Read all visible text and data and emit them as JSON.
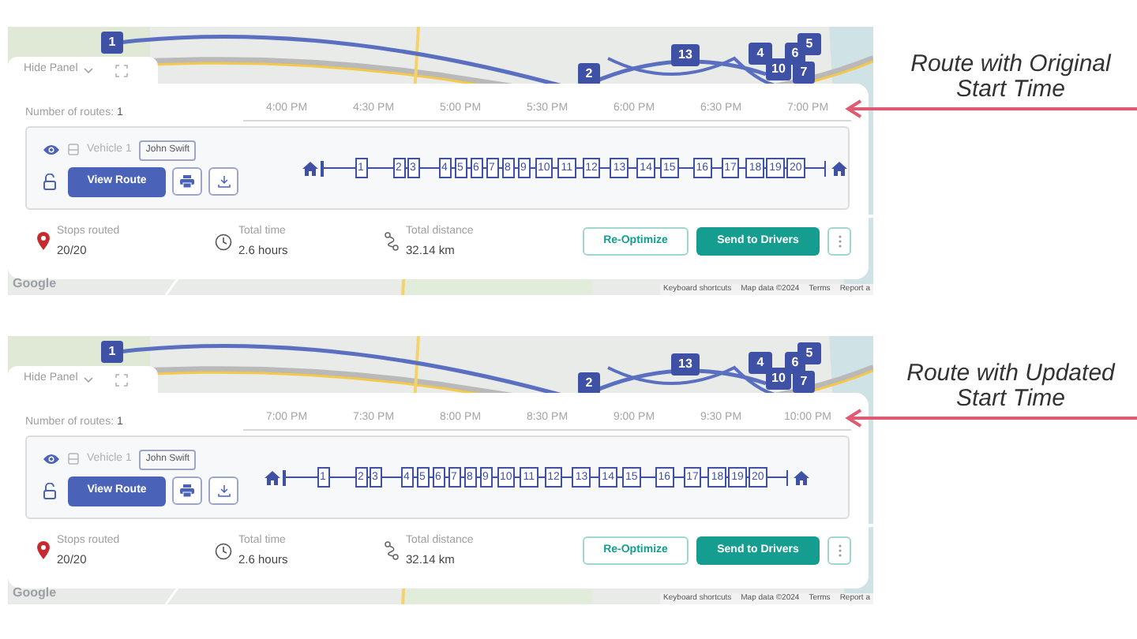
{
  "panels": [
    {
      "markers": [
        "1",
        "2",
        "13",
        "4",
        "5",
        "6",
        "10",
        "7"
      ],
      "hide_panel": "Hide Panel",
      "routes_label": "Number of routes:",
      "routes_count": "1",
      "time_axis": [
        "4:00 PM",
        "4:30 PM",
        "5:00 PM",
        "5:30 PM",
        "6:00 PM",
        "6:30 PM",
        "7:00 PM"
      ],
      "vehicle": "Vehicle 1",
      "driver": "John Swift",
      "view_route": "View Route",
      "stops": [
        "1",
        "2",
        "3",
        "4",
        "5",
        "6",
        "7",
        "8",
        "9",
        "10",
        "11",
        "12",
        "13",
        "14",
        "15",
        "16",
        "17",
        "18",
        "19",
        "20"
      ],
      "stats": [
        {
          "kind": "pin",
          "label": "Stops routed",
          "value": "20/20"
        },
        {
          "kind": "clock",
          "label": "Total time",
          "value": "2.6 hours"
        },
        {
          "kind": "route",
          "label": "Total distance",
          "value": "32.14 km"
        }
      ],
      "reoptimize": "Re-Optimize",
      "send": "Send to Drivers",
      "google": "Google",
      "attribution": [
        "Keyboard shortcuts",
        "Map data ©2024",
        "Terms",
        "Report a"
      ],
      "annotation": [
        "Route with Original",
        "Start Time"
      ]
    },
    {
      "markers": [
        "1",
        "2",
        "13",
        "4",
        "5",
        "6",
        "10",
        "7"
      ],
      "hide_panel": "Hide Panel",
      "routes_label": "Number of routes:",
      "routes_count": "1",
      "time_axis": [
        "7:00 PM",
        "7:30 PM",
        "8:00 PM",
        "8:30 PM",
        "9:00 PM",
        "9:30 PM",
        "10:00 PM"
      ],
      "vehicle": "Vehicle 1",
      "driver": "John Swift",
      "view_route": "View Route",
      "stops": [
        "1",
        "2",
        "3",
        "4",
        "5",
        "6",
        "7",
        "8",
        "9",
        "10",
        "11",
        "12",
        "13",
        "14",
        "15",
        "16",
        "17",
        "18",
        "19",
        "20"
      ],
      "stats": [
        {
          "kind": "pin",
          "label": "Stops routed",
          "value": "20/20"
        },
        {
          "kind": "clock",
          "label": "Total time",
          "value": "2.6 hours"
        },
        {
          "kind": "route",
          "label": "Total distance",
          "value": "32.14 km"
        }
      ],
      "reoptimize": "Re-Optimize",
      "send": "Send to Drivers",
      "google": "Google",
      "attribution": [
        "Keyboard shortcuts",
        "Map data ©2024",
        "Terms",
        "Report a"
      ],
      "annotation": [
        "Route with Updated",
        "Start Time"
      ]
    }
  ]
}
